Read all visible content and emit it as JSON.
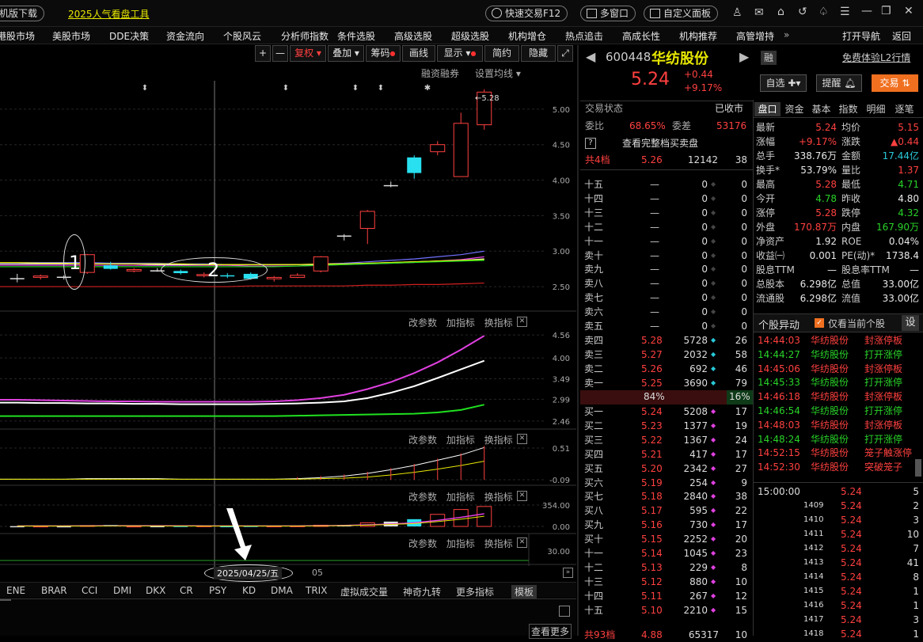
{
  "top": {
    "download": "机版下载",
    "promo": "2025人气看盘工具",
    "quick_trade": "快速交易F12",
    "multi_window": "多窗口",
    "custom_panel": "自定义面板"
  },
  "menu": [
    "港股市场",
    "美股市场",
    "DDE决策",
    "资金流向",
    "个股风云",
    "分析师指数",
    "条件选股",
    "高级选股",
    "超级选股",
    "机构增仓",
    "热点追击",
    "高成长性",
    "机构推荐",
    "高管增持",
    "打开导航",
    "返回"
  ],
  "toolbar": {
    "plus": "+",
    "minus": "—",
    "fuquan": "复权",
    "diejia": "叠加",
    "chouma": "筹码",
    "huaxian": "画线",
    "xianshi": "显示",
    "jianyue": "简约",
    "yincang": "隐藏"
  },
  "chart_header": {
    "rzrq": "融资融券",
    "set_ma": "设置均线"
  },
  "panel_buttons": {
    "params": "改参数",
    "add": "加指标",
    "swap": "换指标",
    "close": "✕"
  },
  "annotations": {
    "one": "1",
    "two": "2",
    "date": "2025/04/25/五",
    "next_month": "05",
    "high_label": "5.28"
  },
  "bottom_tabs": [
    "ENE",
    "BRAR",
    "CCI",
    "DMI",
    "DKX",
    "CR",
    "PSY",
    "KD",
    "DMA",
    "TRIX",
    "虚拟成交量",
    "神奇九转",
    "更多指标",
    "模板"
  ],
  "chart_data": [
    {
      "type": "candlestick",
      "title": "",
      "ylim": [
        2.3,
        5.4
      ],
      "yticks": [
        "5.00",
        "4.50",
        "4.00",
        "3.50",
        "3.00",
        "2.50"
      ],
      "candles": [
        {
          "o": 2.62,
          "c": 2.62,
          "h": 2.68,
          "l": 2.56
        },
        {
          "o": 2.63,
          "c": 2.65,
          "h": 2.67,
          "l": 2.6
        },
        {
          "o": 2.64,
          "c": 2.64,
          "h": 2.66,
          "l": 2.6
        },
        {
          "o": 2.7,
          "c": 2.95,
          "h": 2.96,
          "l": 2.68
        },
        {
          "o": 2.8,
          "c": 2.75,
          "h": 2.85,
          "l": 2.74
        },
        {
          "o": 2.72,
          "c": 2.74,
          "h": 2.76,
          "l": 2.7
        },
        {
          "o": 2.73,
          "c": 2.73,
          "h": 2.76,
          "l": 2.71
        },
        {
          "o": 2.72,
          "c": 2.69,
          "h": 2.74,
          "l": 2.67
        },
        {
          "o": 2.66,
          "c": 2.67,
          "h": 2.7,
          "l": 2.63
        },
        {
          "o": 2.66,
          "c": 2.65,
          "h": 2.69,
          "l": 2.62
        },
        {
          "o": 2.68,
          "c": 2.61,
          "h": 2.7,
          "l": 2.6
        },
        {
          "o": 2.61,
          "c": 2.63,
          "h": 2.65,
          "l": 2.57
        },
        {
          "o": 2.63,
          "c": 2.66,
          "h": 2.69,
          "l": 2.62
        },
        {
          "o": 2.72,
          "c": 2.92,
          "h": 2.93,
          "l": 2.7
        },
        {
          "o": 3.22,
          "c": 3.22,
          "h": 3.24,
          "l": 3.15
        },
        {
          "o": 3.32,
          "c": 3.56,
          "h": 3.58,
          "l": 3.1
        },
        {
          "o": 3.93,
          "c": 3.93,
          "h": 3.98,
          "l": 3.9
        },
        {
          "o": 4.32,
          "c": 4.1,
          "h": 4.35,
          "l": 4.02
        },
        {
          "o": 4.4,
          "c": 4.5,
          "h": 4.55,
          "l": 4.35
        },
        {
          "o": 4.05,
          "c": 4.8,
          "h": 4.95,
          "l": 4.05
        },
        {
          "o": 4.78,
          "c": 5.24,
          "h": 5.28,
          "l": 4.71
        }
      ]
    },
    {
      "type": "line",
      "yticks": [
        "4.56",
        "4.00",
        "3.49",
        "2.99",
        "2.46"
      ],
      "ylim": [
        2.4,
        4.62
      ],
      "series": [
        {
          "color": "#e040e0",
          "values": [
            2.98,
            2.97,
            2.96,
            2.95,
            2.94,
            2.94,
            2.93,
            2.93,
            2.93,
            2.93,
            2.93,
            2.94,
            2.97,
            3.02,
            3.1,
            3.24,
            3.41,
            3.63,
            3.89,
            4.2,
            4.54
          ]
        },
        {
          "color": "#ffffff",
          "values": [
            2.91,
            2.9,
            2.9,
            2.89,
            2.89,
            2.88,
            2.88,
            2.87,
            2.87,
            2.87,
            2.87,
            2.88,
            2.89,
            2.91,
            2.94,
            3.02,
            3.15,
            3.31,
            3.51,
            3.72,
            3.93
          ]
        },
        {
          "color": "#20e020",
          "values": [
            2.58,
            2.58,
            2.58,
            2.58,
            2.58,
            2.58,
            2.58,
            2.58,
            2.58,
            2.58,
            2.58,
            2.58,
            2.59,
            2.6,
            2.61,
            2.62,
            2.63,
            2.64,
            2.67,
            2.73,
            2.86
          ]
        }
      ]
    },
    {
      "type": "line",
      "yticks": [
        "0.51",
        "-0.09"
      ],
      "ylim": [
        -0.15,
        0.6
      ]
    },
    {
      "type": "bar",
      "yticks": [
        "354.00",
        "0.00"
      ],
      "ylim": [
        0,
        380
      ]
    }
  ],
  "stock": {
    "code": "600448",
    "name": "华纺股份",
    "rong": "融",
    "l2": "免费体验L2行情",
    "price": "5.24",
    "change": "+0.44",
    "change_pct": "+9.17%",
    "zixuan": "自选",
    "tixing": "提醒",
    "jiaoyi": "交易",
    "trade_status_label": "交易状态",
    "trade_status": "已收市",
    "weibi_label": "委比",
    "weibi": "68.65%",
    "weicha_label": "委差",
    "weicha": "53176",
    "full_depth": "查看完整档买卖盘",
    "total_levels": "共4档",
    "total_price": "5.26",
    "total_vol": "12142",
    "total_cnt": "38"
  },
  "orderbook_sells": [
    {
      "label": "十五",
      "price": "—",
      "vol": "0",
      "cnt": "0"
    },
    {
      "label": "十四",
      "price": "—",
      "vol": "0",
      "cnt": "0"
    },
    {
      "label": "十三",
      "price": "—",
      "vol": "0",
      "cnt": "0"
    },
    {
      "label": "十二",
      "price": "—",
      "vol": "0",
      "cnt": "0"
    },
    {
      "label": "十一",
      "price": "—",
      "vol": "0",
      "cnt": "0"
    },
    {
      "label": "卖十",
      "price": "—",
      "vol": "0",
      "cnt": "0"
    },
    {
      "label": "卖九",
      "price": "—",
      "vol": "0",
      "cnt": "0"
    },
    {
      "label": "卖八",
      "price": "—",
      "vol": "0",
      "cnt": "0"
    },
    {
      "label": "卖七",
      "price": "—",
      "vol": "0",
      "cnt": "0"
    },
    {
      "label": "卖六",
      "price": "—",
      "vol": "0",
      "cnt": "0"
    },
    {
      "label": "卖五",
      "price": "—",
      "vol": "0",
      "cnt": "0"
    },
    {
      "label": "卖四",
      "price": "5.28",
      "vol": "5728",
      "cnt": "26"
    },
    {
      "label": "卖三",
      "price": "5.27",
      "vol": "2032",
      "cnt": "58"
    },
    {
      "label": "卖二",
      "price": "5.26",
      "vol": "692",
      "cnt": "46"
    },
    {
      "label": "卖一",
      "price": "5.25",
      "vol": "3690",
      "cnt": "79"
    }
  ],
  "ratio": {
    "buy": "84%",
    "sell": "16%"
  },
  "orderbook_buys": [
    {
      "label": "买一",
      "price": "5.24",
      "vol": "5208",
      "cnt": "17"
    },
    {
      "label": "买二",
      "price": "5.23",
      "vol": "1377",
      "cnt": "19"
    },
    {
      "label": "买三",
      "price": "5.22",
      "vol": "1367",
      "cnt": "24"
    },
    {
      "label": "买四",
      "price": "5.21",
      "vol": "417",
      "cnt": "17"
    },
    {
      "label": "买五",
      "price": "5.20",
      "vol": "2342",
      "cnt": "27"
    },
    {
      "label": "买六",
      "price": "5.19",
      "vol": "254",
      "cnt": "9"
    },
    {
      "label": "买七",
      "price": "5.18",
      "vol": "2840",
      "cnt": "38"
    },
    {
      "label": "买八",
      "price": "5.17",
      "vol": "595",
      "cnt": "22"
    },
    {
      "label": "买九",
      "price": "5.16",
      "vol": "730",
      "cnt": "17"
    },
    {
      "label": "买十",
      "price": "5.15",
      "vol": "2252",
      "cnt": "20"
    },
    {
      "label": "十一",
      "price": "5.14",
      "vol": "1045",
      "cnt": "23"
    },
    {
      "label": "十二",
      "price": "5.13",
      "vol": "229",
      "cnt": "8"
    },
    {
      "label": "十三",
      "price": "5.12",
      "vol": "880",
      "cnt": "10"
    },
    {
      "label": "十四",
      "price": "5.11",
      "vol": "267",
      "cnt": "12"
    },
    {
      "label": "十五",
      "price": "5.10",
      "vol": "2210",
      "cnt": "15"
    }
  ],
  "ob_footer": {
    "label": "共93档",
    "price": "4.88",
    "vol": "65317",
    "cnt": "10"
  },
  "tabs": [
    "盘口",
    "资金",
    "基本",
    "指数",
    "明细",
    "逐笔"
  ],
  "quote": [
    {
      "l1": "最新",
      "v1": "5.24",
      "c1": "red",
      "l2": "均价",
      "v2": "5.15",
      "c2": "red"
    },
    {
      "l1": "涨幅",
      "v1": "+9.17%",
      "c1": "red",
      "l2": "涨跌",
      "v2": "▲0.44",
      "c2": "red"
    },
    {
      "l1": "总手",
      "v1": "338.76万",
      "c1": "white",
      "l2": "金额",
      "v2": "17.44亿",
      "c2": "cyan"
    },
    {
      "l1": "换手*",
      "v1": "53.79%",
      "c1": "white",
      "l2": "量比",
      "v2": "1.37",
      "c2": "red"
    },
    {
      "l1": "最高",
      "v1": "5.28",
      "c1": "red",
      "l2": "最低",
      "v2": "4.71",
      "c2": "green"
    },
    {
      "l1": "今开",
      "v1": "4.78",
      "c1": "green",
      "l2": "昨收",
      "v2": "4.80",
      "c2": "white"
    },
    {
      "l1": "涨停",
      "v1": "5.28",
      "c1": "red",
      "l2": "跌停",
      "v2": "4.32",
      "c2": "green"
    },
    {
      "l1": "外盘",
      "v1": "170.87万",
      "c1": "red",
      "l2": "内盘",
      "v2": "167.90万",
      "c2": "green"
    },
    {
      "l1": "净资产",
      "v1": "1.92",
      "c1": "white",
      "l2": "ROE",
      "v2": "0.04%",
      "c2": "white"
    },
    {
      "l1": "收益㈠",
      "v1": "0.001",
      "c1": "white",
      "l2": "PE(动)*",
      "v2": "1738.4",
      "c2": "white"
    },
    {
      "l1": "股息TTM",
      "v1": "—",
      "c1": "white",
      "l2": "股息率TTM",
      "v2": "—",
      "c2": "white"
    },
    {
      "l1": "总股本",
      "v1": "6.298亿",
      "c1": "white",
      "l2": "总值",
      "v2": "33.00亿",
      "c2": "white"
    },
    {
      "l1": "流通股",
      "v1": "6.298亿",
      "c1": "white",
      "l2": "流值",
      "v2": "33.00亿",
      "c2": "white"
    }
  ],
  "alerts_header": {
    "title": "个股异动",
    "only_current": "仅看当前个股",
    "settings": "设"
  },
  "alerts": [
    {
      "time": "14:44:03",
      "name": "华纺股份",
      "event": "封涨停板",
      "c": "red"
    },
    {
      "time": "14:44:27",
      "name": "华纺股份",
      "event": "打开涨停",
      "c": "green"
    },
    {
      "time": "14:45:06",
      "name": "华纺股份",
      "event": "封涨停板",
      "c": "red"
    },
    {
      "time": "14:45:33",
      "name": "华纺股份",
      "event": "打开涨停",
      "c": "green"
    },
    {
      "time": "14:46:18",
      "name": "华纺股份",
      "event": "封涨停板",
      "c": "red"
    },
    {
      "time": "14:46:54",
      "name": "华纺股份",
      "event": "打开涨停",
      "c": "green"
    },
    {
      "time": "14:48:03",
      "name": "华纺股份",
      "event": "封涨停板",
      "c": "red"
    },
    {
      "time": "14:48:24",
      "name": "华纺股份",
      "event": "打开涨停",
      "c": "green"
    },
    {
      "time": "14:52:15",
      "name": "华纺股份",
      "event": "笼子触涨停",
      "c": "red"
    },
    {
      "time": "14:52:30",
      "name": "华纺股份",
      "event": "突破笼子",
      "c": "red"
    }
  ],
  "ticks": [
    {
      "time": "15:00:00",
      "price": "5.24",
      "vol": "5"
    },
    {
      "time": "1409",
      "price": "5.24",
      "vol": "2"
    },
    {
      "time": "1410",
      "price": "5.24",
      "vol": "3"
    },
    {
      "time": "1411",
      "price": "5.24",
      "vol": "10"
    },
    {
      "time": "1412",
      "price": "5.24",
      "vol": "7"
    },
    {
      "time": "1413",
      "price": "5.24",
      "vol": "41"
    },
    {
      "time": "1414",
      "price": "5.24",
      "vol": "8"
    },
    {
      "time": "1415",
      "price": "5.24",
      "vol": "1"
    },
    {
      "time": "1416",
      "price": "5.24",
      "vol": "1"
    },
    {
      "time": "1417",
      "price": "5.24",
      "vol": "3"
    },
    {
      "time": "1418",
      "price": "5.24",
      "vol": "1"
    }
  ],
  "view_more": "查看更多"
}
